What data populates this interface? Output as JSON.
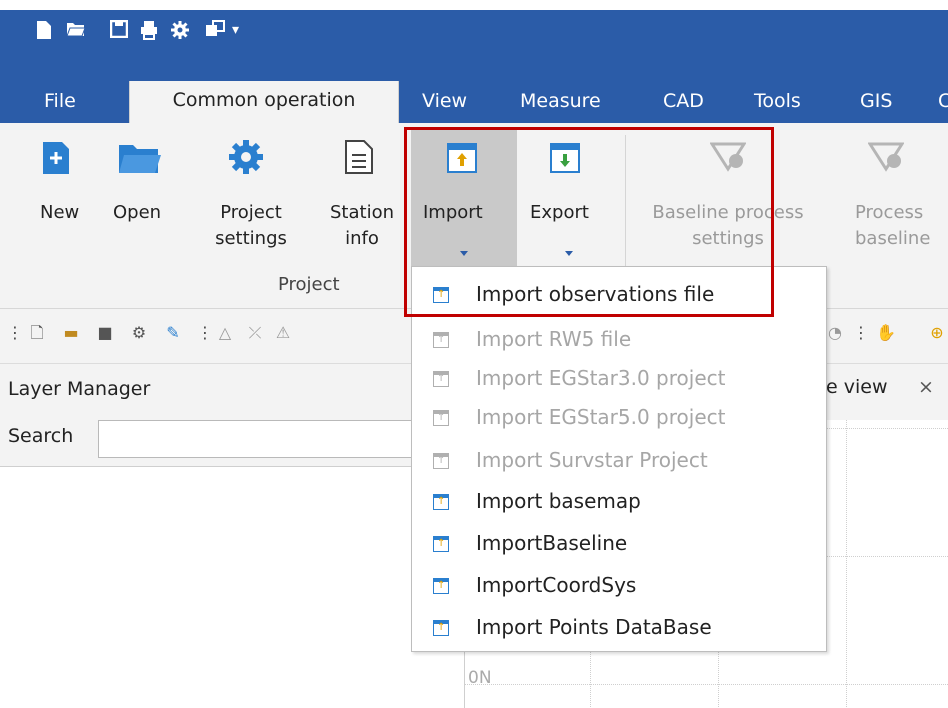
{
  "quick_access": {
    "icons": [
      "new-file-icon",
      "open-folder-icon",
      "save-icon",
      "print-icon",
      "settings-icon",
      "window-icon",
      "customize-dropdown-icon"
    ]
  },
  "tabs": [
    {
      "label": "File"
    },
    {
      "label": "Common operation"
    },
    {
      "label": "View"
    },
    {
      "label": "Measure"
    },
    {
      "label": "CAD"
    },
    {
      "label": "Tools"
    },
    {
      "label": "GIS"
    },
    {
      "label": "C"
    }
  ],
  "ribbon": {
    "new_label": "New",
    "open_label": "Open",
    "project_settings_line1": "Project",
    "project_settings_line2": "settings",
    "station_info_line1": "Station",
    "station_info_line2": "info",
    "import_label": "Import",
    "export_label": "Export",
    "baseline_process_line1": "Baseline process",
    "baseline_process_line2": "settings",
    "process_baseline_line1": "Process",
    "process_baseline_line2": "baseline",
    "group_project": "Project"
  },
  "layer_manager": {
    "title": "Layer Manager",
    "search_label": "Search",
    "search_value": ""
  },
  "view_tab": {
    "label": "e view",
    "close": "×"
  },
  "canvas": {
    "axis_label": "0N"
  },
  "import_menu": {
    "items": [
      {
        "label": "Import observations file",
        "enabled": true
      },
      {
        "label": "Import RW5 file",
        "enabled": false
      },
      {
        "label": "Import EGStar3.0 project",
        "enabled": false
      },
      {
        "label": "Import EGStar5.0 project",
        "enabled": false
      },
      {
        "label": "Import Survstar Project",
        "enabled": false
      },
      {
        "label": "Import basemap",
        "enabled": true
      },
      {
        "label": "ImportBaseline",
        "enabled": true
      },
      {
        "label": "ImportCoordSys",
        "enabled": true
      },
      {
        "label": "Import Points DataBase",
        "enabled": true
      }
    ]
  },
  "colors": {
    "titlebar": "#2b5ca8",
    "ribbon_bg": "#f3f3f3",
    "highlight_box": "#c00000",
    "icon_blue": "#2a7fcf"
  }
}
